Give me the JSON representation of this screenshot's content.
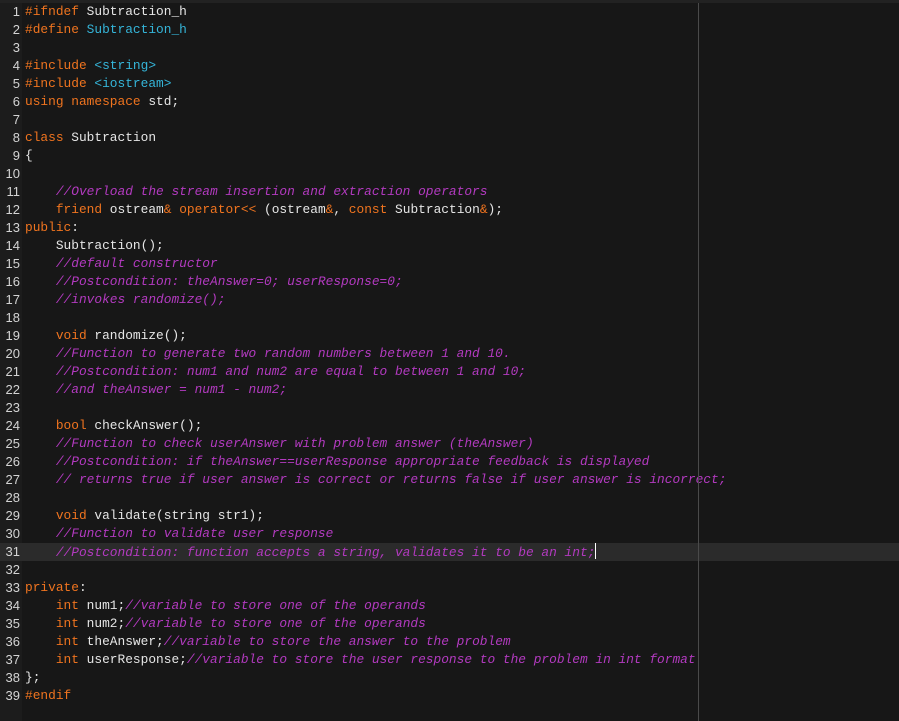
{
  "editor": {
    "language": "cpp",
    "current_line": 31,
    "ruler_column": 88,
    "colors": {
      "background": "#171717",
      "gutter": "#1c1c1c",
      "current_line": "#2b2b2b",
      "keyword": "#f0741f",
      "macro": "#35b5d9",
      "comment": "#b33ac0",
      "text": "#e6e6e6"
    },
    "lines": [
      {
        "n": "1",
        "tokens": [
          [
            "pp",
            "#ifndef"
          ],
          [
            "id",
            " "
          ],
          [
            "id",
            "Subtraction_h"
          ]
        ]
      },
      {
        "n": "2",
        "tokens": [
          [
            "pp",
            "#define"
          ],
          [
            "id",
            " "
          ],
          [
            "macro",
            "Subtraction_h"
          ]
        ]
      },
      {
        "n": "3",
        "tokens": []
      },
      {
        "n": "4",
        "tokens": [
          [
            "pp",
            "#include"
          ],
          [
            "id",
            " "
          ],
          [
            "inc",
            "<string>"
          ]
        ]
      },
      {
        "n": "5",
        "tokens": [
          [
            "pp",
            "#include"
          ],
          [
            "id",
            " "
          ],
          [
            "inc",
            "<iostream>"
          ]
        ]
      },
      {
        "n": "6",
        "tokens": [
          [
            "kw",
            "using"
          ],
          [
            "id",
            " "
          ],
          [
            "kw",
            "namespace"
          ],
          [
            "id",
            " std;"
          ]
        ]
      },
      {
        "n": "7",
        "tokens": []
      },
      {
        "n": "8",
        "tokens": [
          [
            "kw",
            "class"
          ],
          [
            "id",
            " Subtraction"
          ]
        ]
      },
      {
        "n": "9",
        "tokens": [
          [
            "pn",
            "{"
          ]
        ]
      },
      {
        "n": "10",
        "tokens": []
      },
      {
        "n": "11",
        "tokens": [
          [
            "id",
            "    "
          ],
          [
            "cm",
            "//Overload the stream insertion and extraction operators"
          ]
        ]
      },
      {
        "n": "12",
        "tokens": [
          [
            "id",
            "    "
          ],
          [
            "kw",
            "friend"
          ],
          [
            "id",
            " ostream"
          ],
          [
            "op",
            "&"
          ],
          [
            "id",
            " "
          ],
          [
            "kw",
            "operator<<"
          ],
          [
            "id",
            " (ostream"
          ],
          [
            "op",
            "&"
          ],
          [
            "id",
            ", "
          ],
          [
            "kw",
            "const"
          ],
          [
            "id",
            " Subtraction"
          ],
          [
            "op",
            "&"
          ],
          [
            "id",
            ");"
          ]
        ]
      },
      {
        "n": "13",
        "tokens": [
          [
            "kw",
            "public"
          ],
          [
            "pn",
            ":"
          ]
        ]
      },
      {
        "n": "14",
        "tokens": [
          [
            "id",
            "    Subtraction();"
          ]
        ]
      },
      {
        "n": "15",
        "tokens": [
          [
            "id",
            "    "
          ],
          [
            "cm",
            "//default constructor"
          ]
        ]
      },
      {
        "n": "16",
        "tokens": [
          [
            "id",
            "    "
          ],
          [
            "cm",
            "//Postcondition: theAnswer=0; userResponse=0;"
          ]
        ]
      },
      {
        "n": "17",
        "tokens": [
          [
            "id",
            "    "
          ],
          [
            "cm",
            "//invokes randomize();"
          ]
        ]
      },
      {
        "n": "18",
        "tokens": []
      },
      {
        "n": "19",
        "tokens": [
          [
            "id",
            "    "
          ],
          [
            "kw",
            "void"
          ],
          [
            "id",
            " randomize();"
          ]
        ]
      },
      {
        "n": "20",
        "tokens": [
          [
            "id",
            "    "
          ],
          [
            "cm",
            "//Function to generate two random numbers between 1 and 10."
          ]
        ]
      },
      {
        "n": "21",
        "tokens": [
          [
            "id",
            "    "
          ],
          [
            "cm",
            "//Postcondition: num1 and num2 are equal to between 1 and 10;"
          ]
        ]
      },
      {
        "n": "22",
        "tokens": [
          [
            "id",
            "    "
          ],
          [
            "cm",
            "//and theAnswer = num1 - num2;"
          ]
        ]
      },
      {
        "n": "23",
        "tokens": []
      },
      {
        "n": "24",
        "tokens": [
          [
            "id",
            "    "
          ],
          [
            "kw",
            "bool"
          ],
          [
            "id",
            " checkAnswer();"
          ]
        ]
      },
      {
        "n": "25",
        "tokens": [
          [
            "id",
            "    "
          ],
          [
            "cm",
            "//Function to check userAnswer with problem answer (theAnswer)"
          ]
        ]
      },
      {
        "n": "26",
        "tokens": [
          [
            "id",
            "    "
          ],
          [
            "cm",
            "//Postcondition: if theAnswer==userResponse appropriate feedback is displayed"
          ]
        ]
      },
      {
        "n": "27",
        "tokens": [
          [
            "id",
            "    "
          ],
          [
            "cm",
            "// returns true if user answer is correct or returns false if user answer is incorrect;"
          ]
        ]
      },
      {
        "n": "28",
        "tokens": []
      },
      {
        "n": "29",
        "tokens": [
          [
            "id",
            "    "
          ],
          [
            "kw",
            "void"
          ],
          [
            "id",
            " validate(string str1);"
          ]
        ]
      },
      {
        "n": "30",
        "tokens": [
          [
            "id",
            "    "
          ],
          [
            "cm",
            "//Function to validate user response"
          ]
        ]
      },
      {
        "n": "31",
        "tokens": [
          [
            "id",
            "    "
          ],
          [
            "cm",
            "//Postcondition: function accepts a string, validates it to be an int;"
          ]
        ]
      },
      {
        "n": "32",
        "tokens": []
      },
      {
        "n": "33",
        "tokens": [
          [
            "kw",
            "private"
          ],
          [
            "pn",
            ":"
          ]
        ]
      },
      {
        "n": "34",
        "tokens": [
          [
            "id",
            "    "
          ],
          [
            "kw",
            "int"
          ],
          [
            "id",
            " num1;"
          ],
          [
            "cm",
            "//variable to store one of the operands"
          ]
        ]
      },
      {
        "n": "35",
        "tokens": [
          [
            "id",
            "    "
          ],
          [
            "kw",
            "int"
          ],
          [
            "id",
            " num2;"
          ],
          [
            "cm",
            "//variable to store one of the operands"
          ]
        ]
      },
      {
        "n": "36",
        "tokens": [
          [
            "id",
            "    "
          ],
          [
            "kw",
            "int"
          ],
          [
            "id",
            " theAnswer;"
          ],
          [
            "cm",
            "//variable to store the answer to the problem"
          ]
        ]
      },
      {
        "n": "37",
        "tokens": [
          [
            "id",
            "    "
          ],
          [
            "kw",
            "int"
          ],
          [
            "id",
            " userResponse;"
          ],
          [
            "cm",
            "//variable to store the user response to the problem in int format"
          ]
        ]
      },
      {
        "n": "38",
        "tokens": [
          [
            "pn",
            "};"
          ]
        ]
      },
      {
        "n": "39",
        "tokens": [
          [
            "pp",
            "#endif"
          ]
        ]
      }
    ]
  }
}
